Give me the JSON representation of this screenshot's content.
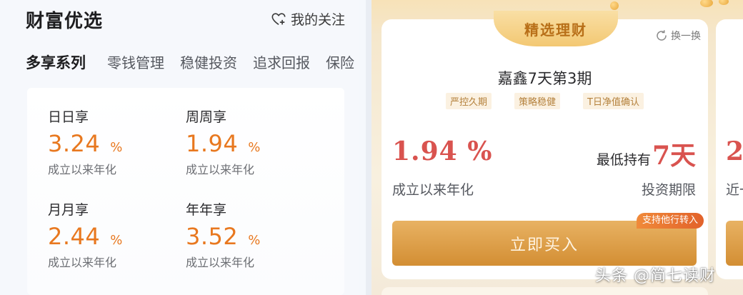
{
  "left": {
    "title": "财富优选",
    "follow_label": "我的关注",
    "tabs": [
      {
        "label": "多享系列",
        "active": true
      },
      {
        "label": "零钱管理",
        "active": false
      },
      {
        "label": "稳健投资",
        "active": false
      },
      {
        "label": "追求回报",
        "active": false
      },
      {
        "label": "保险",
        "active": false
      }
    ],
    "products": [
      {
        "name": "日日享",
        "rate": "3.24",
        "unit": "%",
        "sub": "成立以来年化"
      },
      {
        "name": "周周享",
        "rate": "1.94",
        "unit": "%",
        "sub": "成立以来年化"
      },
      {
        "name": "月月享",
        "rate": "2.44",
        "unit": "%",
        "sub": "成立以来年化"
      },
      {
        "name": "年年享",
        "rate": "3.52",
        "unit": "%",
        "sub": "成立以来年化"
      }
    ]
  },
  "right": {
    "ribbon_label": "精选理财",
    "refresh_label": "换一换",
    "fund_name": "嘉鑫7天第3期",
    "tags": [
      "严控久期",
      "策略稳健",
      "T日净值确认"
    ],
    "rate": "1.94 %",
    "min_hold_label": "最低持有",
    "min_hold_value": "7天",
    "rate_caption": "成立以来年化",
    "period_caption": "投资期限",
    "buy_label": "立即买入",
    "transfer_badge": "支持他行转入",
    "next_card": {
      "rate_partial": "2.",
      "caption_partial": "近一"
    }
  },
  "watermark": "头条 @简七读财",
  "colors": {
    "accent_orange": "#e8781f",
    "rate_red": "#d9534f",
    "gold": "#d38e33"
  }
}
